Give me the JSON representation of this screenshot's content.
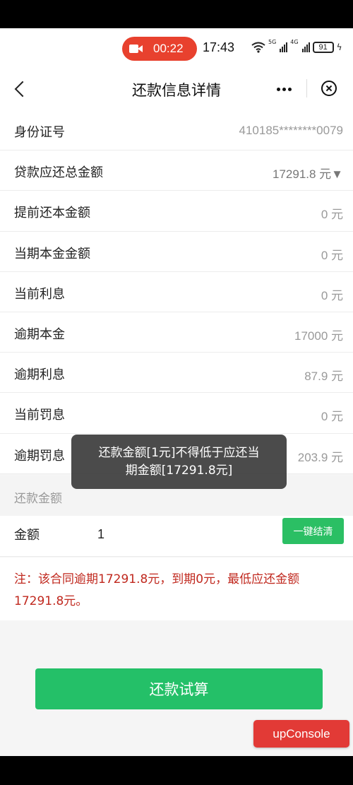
{
  "status_bar": {
    "recording_time": "00:22",
    "clock": "17:43",
    "network_1": "5G",
    "network_2": "4G",
    "battery": "91"
  },
  "nav": {
    "title": "还款信息详情"
  },
  "info_rows": [
    {
      "label": "身份证号",
      "value": "410185********0079"
    },
    {
      "label": "贷款应还总金额",
      "value": "17291.8 元▼"
    },
    {
      "label": "提前还本金额",
      "value": "0 元"
    },
    {
      "label": "当期本金金额",
      "value": "0 元"
    },
    {
      "label": "当前利息",
      "value": "0 元"
    },
    {
      "label": "逾期本金",
      "value": "17000 元"
    },
    {
      "label": "逾期利息",
      "value": "87.9 元"
    },
    {
      "label": "当前罚息",
      "value": "0 元"
    },
    {
      "label": "逾期罚息",
      "value": "203.9 元"
    }
  ],
  "repay_section": {
    "title": "还款金额",
    "amount_label": "金额",
    "amount_value": "1",
    "settle_button": "一键结清"
  },
  "note": "注：该合同逾期17291.8元，到期0元，最低应还金额17291.8元。",
  "calc_button": "还款试算",
  "console_button": "upConsole",
  "toast": {
    "line1": "还款金额[1元]不得低于应还当",
    "line2": "期金额[17291.8元]"
  }
}
